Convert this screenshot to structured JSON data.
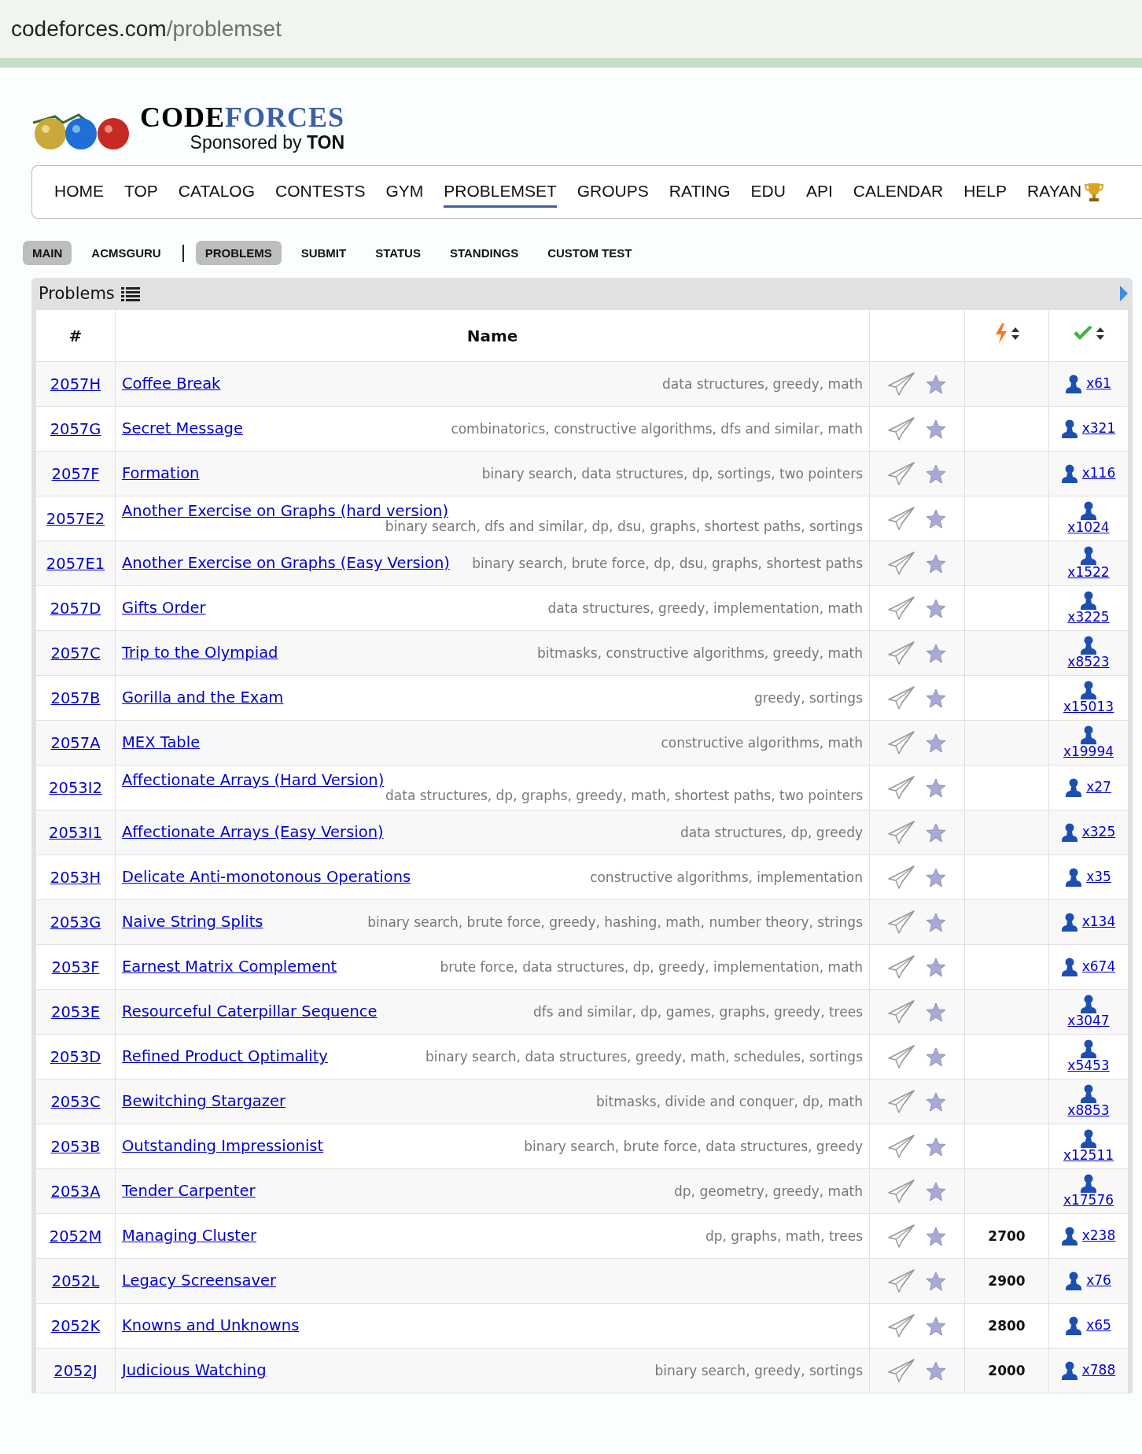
{
  "address_bar": {
    "host": "codeforces.com",
    "path": "/problemset"
  },
  "logo": {
    "dark": "CODE",
    "blue": "FORCES",
    "sponsor": "Sponsored by",
    "sponsor_name": "TON"
  },
  "nav": [
    {
      "label": "HOME",
      "selected": false
    },
    {
      "label": "TOP",
      "selected": false
    },
    {
      "label": "CATALOG",
      "selected": false
    },
    {
      "label": "CONTESTS",
      "selected": false
    },
    {
      "label": "GYM",
      "selected": false
    },
    {
      "label": "PROBLEMSET",
      "selected": true
    },
    {
      "label": "GROUPS",
      "selected": false
    },
    {
      "label": "RATING",
      "selected": false
    },
    {
      "label": "EDU",
      "selected": false
    },
    {
      "label": "API",
      "selected": false
    },
    {
      "label": "CALENDAR",
      "selected": false
    },
    {
      "label": "HELP",
      "selected": false
    },
    {
      "label": "RAYAN",
      "selected": false,
      "kind": "trophy"
    }
  ],
  "subnav_left": [
    {
      "label": "MAIN",
      "selected": true
    },
    {
      "label": "ACMSGURU",
      "selected": false
    }
  ],
  "subnav_right": [
    {
      "label": "PROBLEMS",
      "selected": true
    },
    {
      "label": "SUBMIT",
      "selected": false
    },
    {
      "label": "STATUS",
      "selected": false
    },
    {
      "label": "STANDINGS",
      "selected": false
    },
    {
      "label": "CUSTOM TEST",
      "selected": false
    }
  ],
  "panel": {
    "title": "Problems"
  },
  "table": {
    "columns": [
      "#",
      "Name"
    ],
    "rows": [
      {
        "id": "2057H",
        "name": "Coffee Break",
        "tags": "data structures, greedy, math",
        "solved": "x61"
      },
      {
        "id": "2057G",
        "name": "Secret Message",
        "tags": "combinatorics, constructive algorithms, dfs and similar, math",
        "solved": "x321"
      },
      {
        "id": "2057F",
        "name": "Formation",
        "tags": "binary search, data structures, dp, sortings, two pointers",
        "solved": "x116"
      },
      {
        "id": "2057E2",
        "name": "Another Exercise on Graphs (hard version)",
        "tags": "binary search, dfs and similar, dp, dsu, graphs, shortest paths, sortings",
        "solved": "x1024"
      },
      {
        "id": "2057E1",
        "name": "Another Exercise on Graphs (Easy Version)",
        "tags": "binary search, brute force, dp, dsu, graphs, shortest paths",
        "solved": "x1522"
      },
      {
        "id": "2057D",
        "name": "Gifts Order",
        "tags": "data structures, greedy, implementation, math",
        "solved": "x3225"
      },
      {
        "id": "2057C",
        "name": "Trip to the Olympiad",
        "tags": "bitmasks, constructive algorithms, greedy, math",
        "solved": "x8523"
      },
      {
        "id": "2057B",
        "name": "Gorilla and the Exam",
        "tags": "greedy, sortings",
        "solved": "x15013"
      },
      {
        "id": "2057A",
        "name": "MEX Table",
        "tags": "constructive algorithms, math",
        "solved": "x19994"
      },
      {
        "id": "2053I2",
        "name": "Affectionate Arrays (Hard Version)",
        "tags": "data structures, dp, graphs, greedy, math, shortest paths, two pointers",
        "solved": "x27"
      },
      {
        "id": "2053I1",
        "name": "Affectionate Arrays (Easy Version)",
        "tags": "data structures, dp, greedy",
        "solved": "x325"
      },
      {
        "id": "2053H",
        "name": "Delicate Anti-monotonous Operations",
        "tags": "constructive algorithms, implementation",
        "solved": "x35"
      },
      {
        "id": "2053G",
        "name": "Naive String Splits",
        "tags": "binary search, brute force, greedy, hashing, math, number theory, strings",
        "solved": "x134"
      },
      {
        "id": "2053F",
        "name": "Earnest Matrix Complement",
        "tags": "brute force, data structures, dp, greedy, implementation, math",
        "solved": "x674"
      },
      {
        "id": "2053E",
        "name": "Resourceful Caterpillar Sequence",
        "tags": "dfs and similar, dp, games, graphs, greedy, trees",
        "solved": "x3047"
      },
      {
        "id": "2053D",
        "name": "Refined Product Optimality",
        "tags": "binary search, data structures, greedy, math, schedules, sortings",
        "solved": "x5453"
      },
      {
        "id": "2053C",
        "name": "Bewitching Stargazer",
        "tags": "bitmasks, divide and conquer, dp, math",
        "solved": "x8853"
      },
      {
        "id": "2053B",
        "name": "Outstanding Impressionist",
        "tags": "binary search, brute force, data structures, greedy",
        "solved": "x12511"
      },
      {
        "id": "2053A",
        "name": "Tender Carpenter",
        "tags": "dp, geometry, greedy, math",
        "solved": "x17576"
      },
      {
        "id": "2052M",
        "name": "Managing Cluster",
        "tags": "dp, graphs, math, trees",
        "rating": "2700",
        "solved": "x238"
      },
      {
        "id": "2052L",
        "name": "Legacy Screensaver",
        "rating": "2900",
        "solved": "x76"
      },
      {
        "id": "2052K",
        "name": "Knowns and Unknowns",
        "rating": "2800",
        "solved": "x65"
      },
      {
        "id": "2052J",
        "name": "Judicious Watching",
        "tags": "binary search, greedy, sortings",
        "rating": "2000",
        "solved": "x788"
      }
    ]
  }
}
